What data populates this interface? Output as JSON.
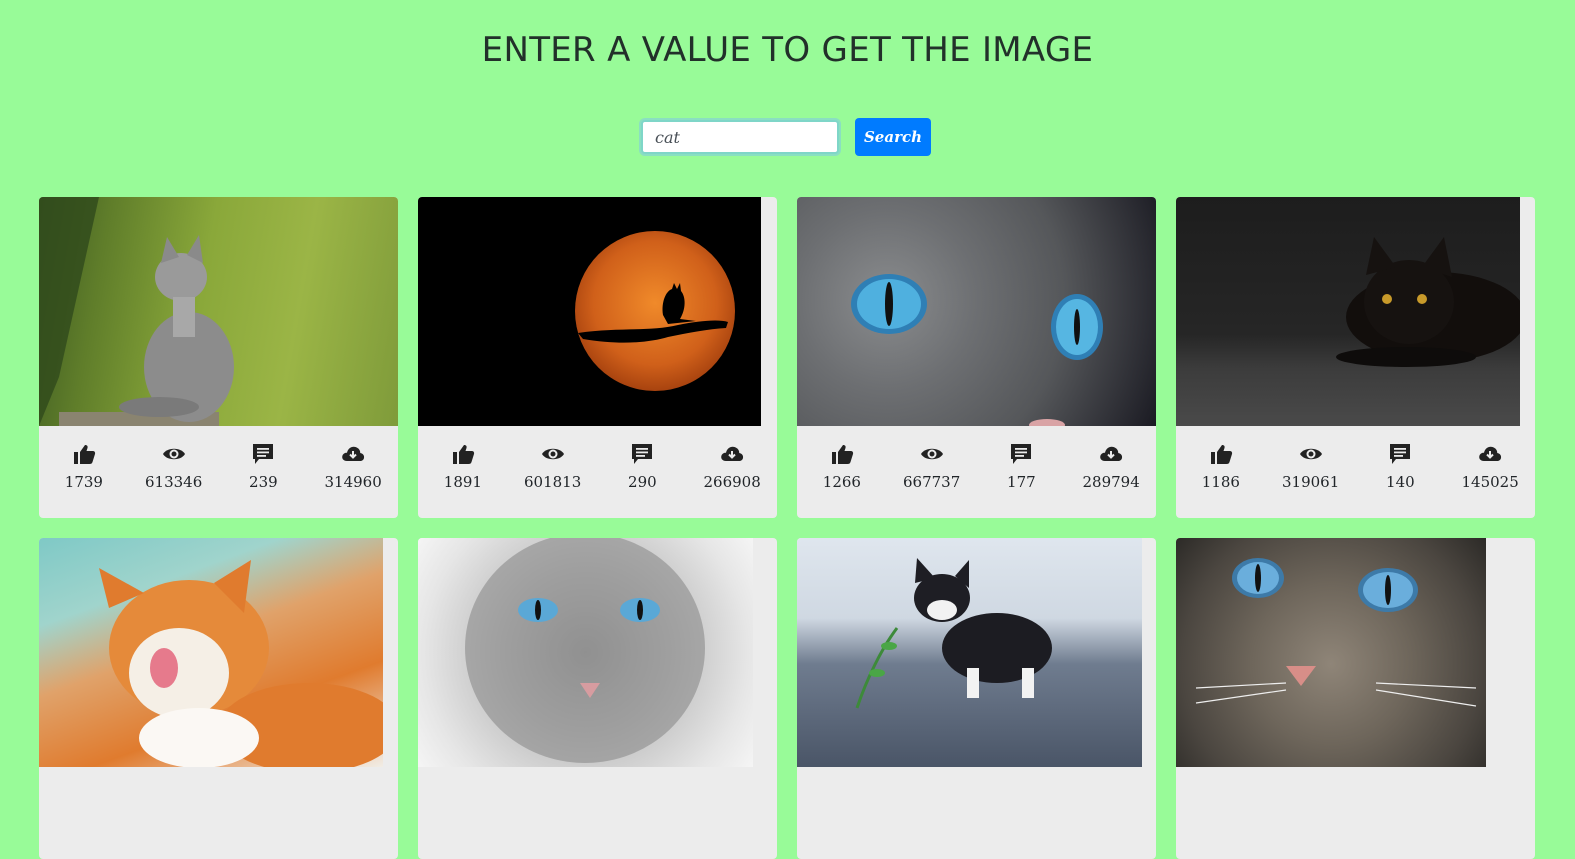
{
  "header": {
    "title": "ENTER A VALUE TO GET THE IMAGE"
  },
  "search": {
    "value": "cat",
    "button_label": "Search"
  },
  "colors": {
    "background": "#98fb98",
    "card": "#ececec",
    "button": "#007bff"
  },
  "stat_icons": [
    "thumbs-up-icon",
    "eye-icon",
    "comment-icon",
    "cloud-download-icon"
  ],
  "cards": [
    {
      "image": "kitten-looking-up-photo",
      "likes": "1739",
      "views": "613346",
      "comments": "239",
      "downloads": "314960"
    },
    {
      "image": "cat-silhouette-moon-photo",
      "likes": "1891",
      "views": "601813",
      "comments": "290",
      "downloads": "266908"
    },
    {
      "image": "blue-eyed-cat-closeup-photo",
      "likes": "1266",
      "views": "667737",
      "comments": "177",
      "downloads": "289794"
    },
    {
      "image": "black-cat-dark-photo",
      "likes": "1186",
      "views": "319061",
      "comments": "140",
      "downloads": "145025"
    },
    {
      "image": "orange-cat-licking-photo"
    },
    {
      "image": "fluffy-gray-cat-photo"
    },
    {
      "image": "kitten-with-plant-photo"
    },
    {
      "image": "tabby-cat-face-photo"
    }
  ]
}
